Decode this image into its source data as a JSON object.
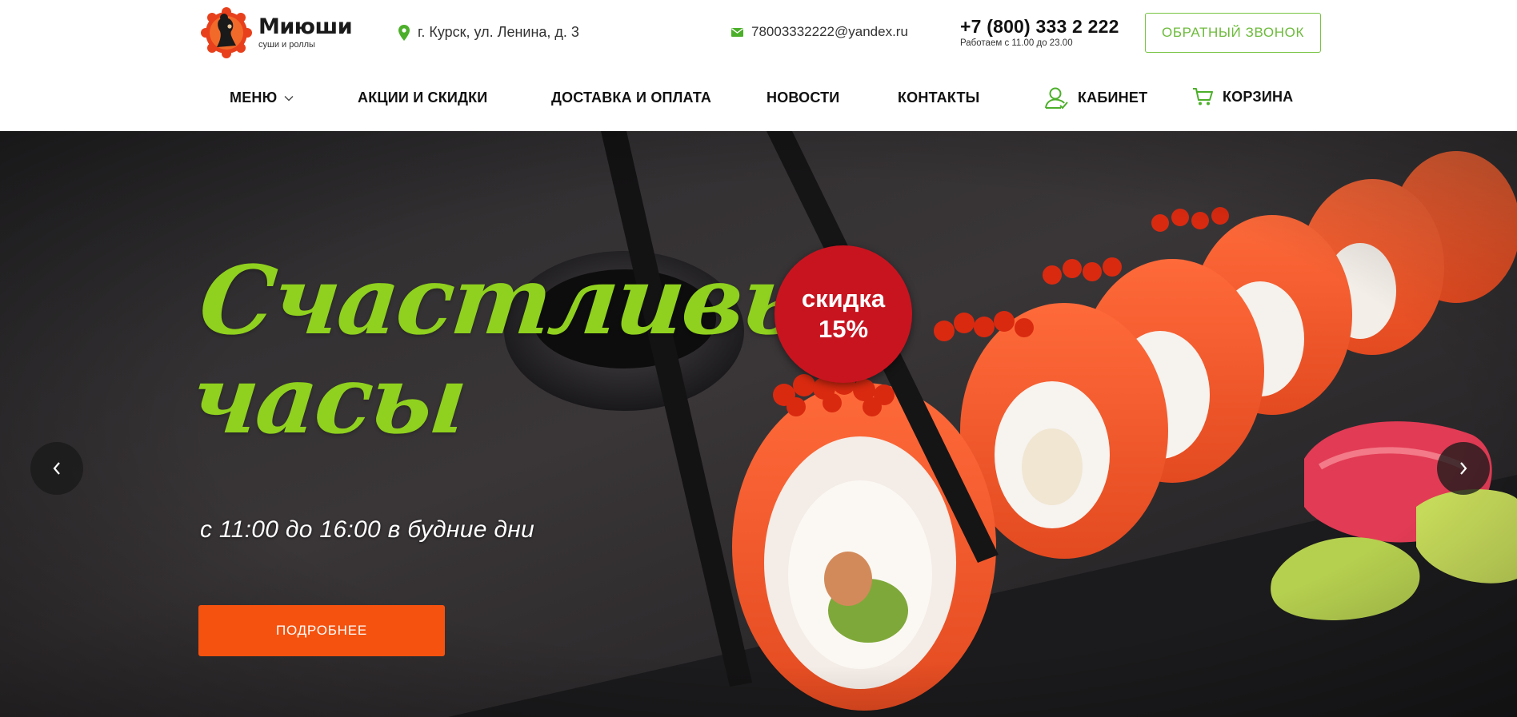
{
  "brand": {
    "name": "Миюши",
    "tagline": "суши и роллы"
  },
  "header": {
    "address": "г. Курск, ул. Ленина, д. 3",
    "email": "78003332222@yandex.ru",
    "phone": "+7 (800) 333 2 222",
    "hours": "Работаем с 11.00 до 23.00",
    "callback_label": "ОБРАТНЫЙ ЗВОНОК"
  },
  "nav": {
    "menu": "МЕНЮ",
    "promos": "АКЦИИ И СКИДКИ",
    "delivery": "ДОСТАВКА И ОПЛАТА",
    "news": "НОВОСТИ",
    "contacts": "КОНТАКТЫ",
    "cabinet": "КАБИНЕТ",
    "cart": "КОРЗИНА"
  },
  "hero": {
    "title_line1": "Счастливые",
    "title_line2": "часы",
    "badge_line1": "скидка",
    "badge_line2": "15%",
    "subtitle": "с 11:00 до 16:00 в будние дни",
    "button_label": "ПОДРОБНЕЕ"
  },
  "colors": {
    "accent_green": "#6dbb3c",
    "title_green": "#8fd11e",
    "button_orange": "#f5520f",
    "badge_red": "#c8141f"
  },
  "icons": {
    "address": "map-pin-icon",
    "email": "envelope-icon",
    "menu": "chevron-down-icon",
    "cabinet": "user-icon",
    "cart": "cart-icon",
    "prev": "chevron-left-icon",
    "next": "chevron-right-icon"
  }
}
